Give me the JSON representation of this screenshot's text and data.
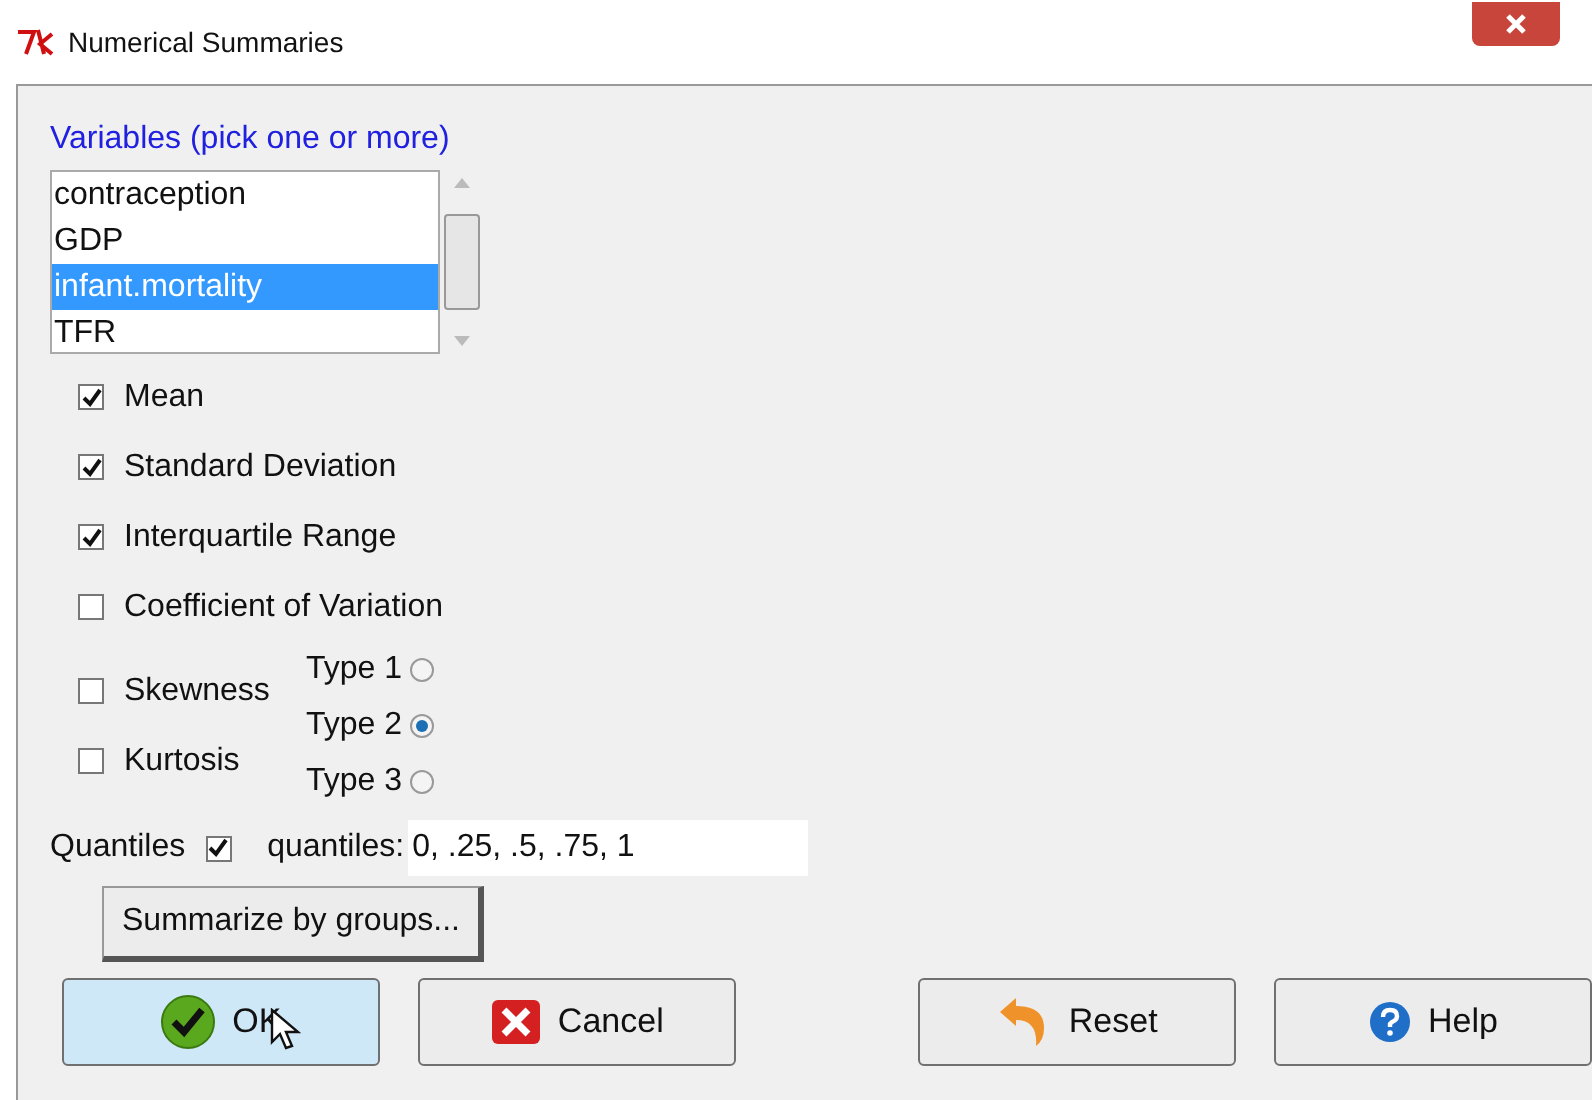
{
  "window": {
    "title": "Numerical Summaries"
  },
  "variables": {
    "label": "Variables (pick one or more)",
    "items": [
      {
        "label": "contraception",
        "selected": false
      },
      {
        "label": "GDP",
        "selected": false
      },
      {
        "label": "infant.mortality",
        "selected": true
      },
      {
        "label": "TFR",
        "selected": false
      }
    ]
  },
  "statistics": [
    {
      "label": "Mean",
      "checked": true
    },
    {
      "label": "Standard Deviation",
      "checked": true
    },
    {
      "label": "Interquartile Range",
      "checked": true
    },
    {
      "label": "Coefficient of Variation",
      "checked": false
    }
  ],
  "shape": [
    {
      "label": "Skewness",
      "checked": false
    },
    {
      "label": "Kurtosis",
      "checked": false
    }
  ],
  "types": [
    {
      "label": "Type 1",
      "selected": false
    },
    {
      "label": "Type 2",
      "selected": true
    },
    {
      "label": "Type 3",
      "selected": false
    }
  ],
  "quantiles": {
    "label": "Quantiles",
    "checked": true,
    "field_label": "quantiles:",
    "value": "0, .25, .5, .75, 1"
  },
  "groups_button": "Summarize by groups...",
  "buttons": [
    {
      "label": "OK",
      "kind": "ok"
    },
    {
      "label": "Cancel",
      "kind": "cancel"
    },
    {
      "label": "Reset",
      "kind": "reset"
    },
    {
      "label": "Help",
      "kind": "help"
    }
  ]
}
